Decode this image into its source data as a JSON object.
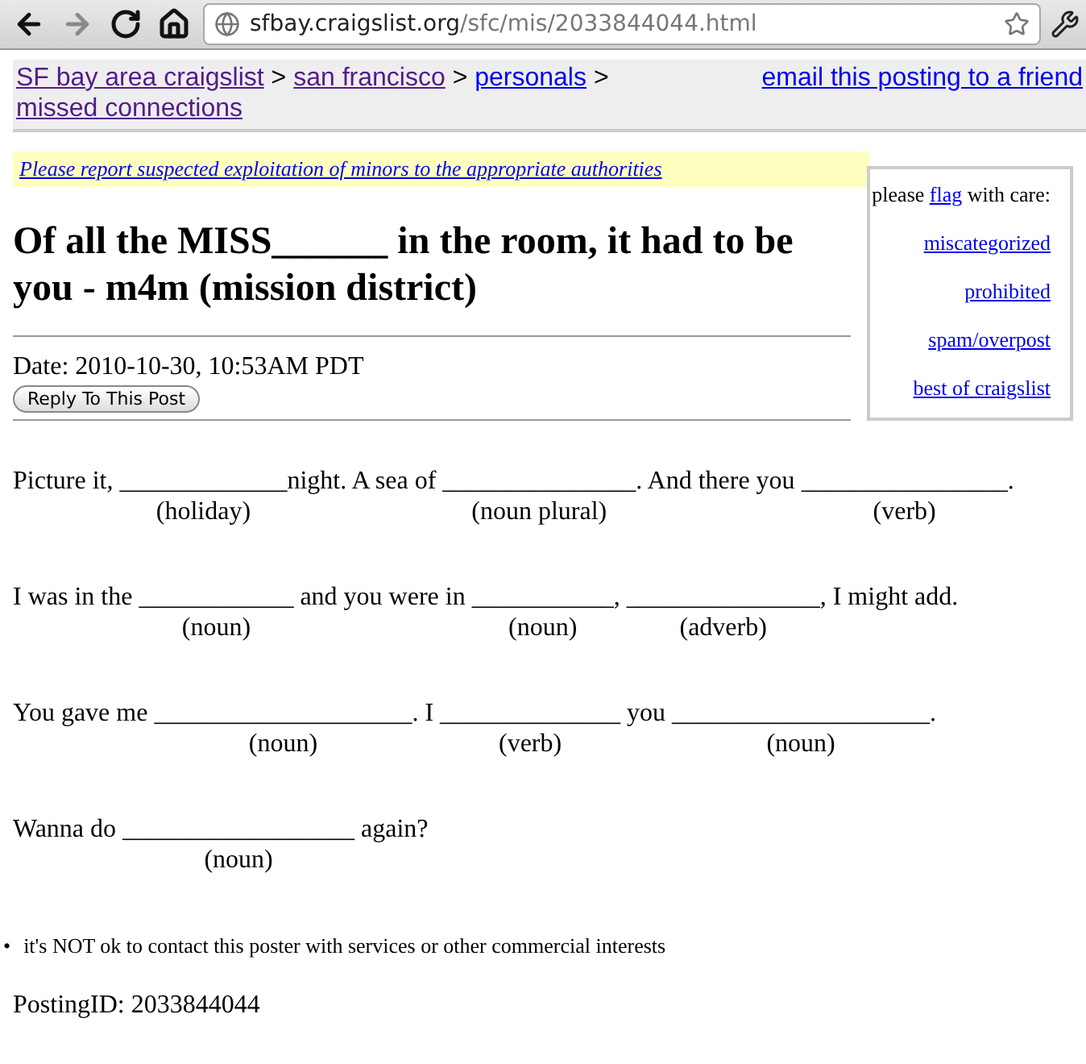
{
  "browser": {
    "nav": [
      {
        "kind": "back",
        "disabled": false
      },
      {
        "kind": "forward",
        "disabled": true
      },
      {
        "kind": "reload",
        "disabled": false
      },
      {
        "kind": "home",
        "disabled": false
      }
    ],
    "url_host": "sfbay.craigslist.org",
    "url_path": "/sfc/mis/2033844044.html"
  },
  "breadcrumbs": [
    {
      "label": "SF bay area craigslist",
      "visited": true
    },
    {
      "label": "san francisco",
      "visited": true
    },
    {
      "label": "personals",
      "visited": false
    },
    {
      "label": "missed connections",
      "visited": true
    }
  ],
  "separator": ">",
  "email_link": "email this posting to a friend",
  "notice": "Please report suspected exploitation of minors to the appropriate authorities",
  "flag_box": {
    "before": "please ",
    "flag": "flag",
    "after": " with care:",
    "links": [
      "miscategorized",
      "prohibited",
      "spam/overpost",
      "best of craigslist"
    ]
  },
  "title": "Of all the MISS______ in the room, it had to be you - m4m (mission district)",
  "date": "Date: 2010-10-30, 10:53AM PDT",
  "reply_button": "Reply To This Post",
  "lines": [
    {
      "segments": [
        {
          "kind": "text",
          "text": "Picture it, "
        },
        {
          "kind": "blank",
          "line": "_____________",
          "hint": "(holiday)"
        },
        {
          "kind": "text",
          "text": "night. A sea of "
        },
        {
          "kind": "blank",
          "line": "_______________",
          "hint": "(noun plural)"
        },
        {
          "kind": "text",
          "text": ". And there you "
        },
        {
          "kind": "blank",
          "line": "________________",
          "hint": "(verb)"
        },
        {
          "kind": "text",
          "text": "."
        }
      ]
    },
    {
      "segments": [
        {
          "kind": "text",
          "text": "I was in the "
        },
        {
          "kind": "blank",
          "line": "____________",
          "hint": "(noun)"
        },
        {
          "kind": "text",
          "text": " and you were in "
        },
        {
          "kind": "blank",
          "line": "___________",
          "hint": "(noun)"
        },
        {
          "kind": "text",
          "text": ", "
        },
        {
          "kind": "blank",
          "line": "_______________",
          "hint": "(adverb)"
        },
        {
          "kind": "text",
          "text": ", I might add."
        }
      ]
    },
    {
      "segments": [
        {
          "kind": "text",
          "text": "You gave me "
        },
        {
          "kind": "blank",
          "line": "____________________",
          "hint": "(noun)"
        },
        {
          "kind": "text",
          "text": ". I "
        },
        {
          "kind": "blank",
          "line": "______________",
          "hint": "(verb)"
        },
        {
          "kind": "text",
          "text": " you "
        },
        {
          "kind": "blank",
          "line": "____________________",
          "hint": "(noun)"
        },
        {
          "kind": "text",
          "text": "."
        }
      ]
    },
    {
      "segments": [
        {
          "kind": "text",
          "text": "Wanna do "
        },
        {
          "kind": "blank",
          "line": "__________________",
          "hint": "(noun)"
        },
        {
          "kind": "text",
          "text": " again?"
        }
      ]
    }
  ],
  "bullet_mark": "•",
  "bullets": [
    "it's NOT ok to contact this poster with services or other commercial interests"
  ],
  "posting_id": "PostingID: 2033844044"
}
